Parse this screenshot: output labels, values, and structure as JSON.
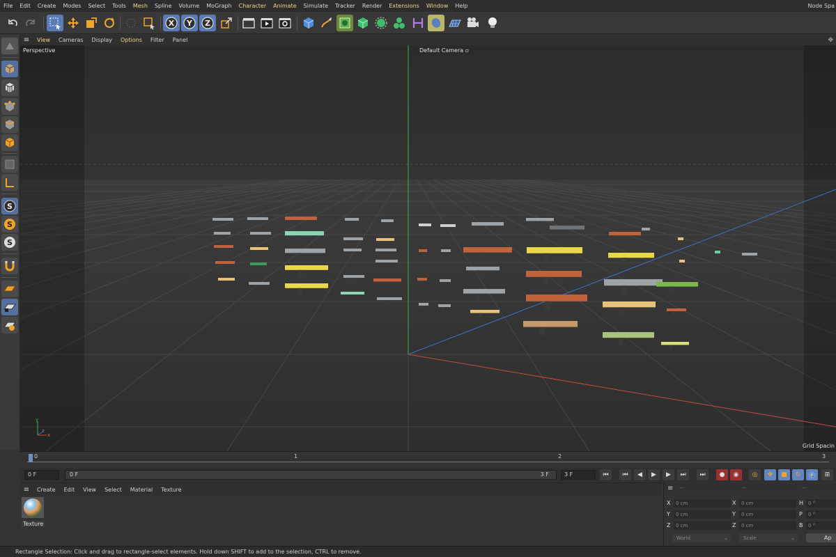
{
  "menu": {
    "items": [
      {
        "label": "File",
        "highlight": false
      },
      {
        "label": "Edit",
        "highlight": false
      },
      {
        "label": "Create",
        "highlight": false
      },
      {
        "label": "Modes",
        "highlight": false
      },
      {
        "label": "Select",
        "highlight": false
      },
      {
        "label": "Tools",
        "highlight": false
      },
      {
        "label": "Mesh",
        "highlight": true
      },
      {
        "label": "Spline",
        "highlight": false
      },
      {
        "label": "Volume",
        "highlight": false
      },
      {
        "label": "MoGraph",
        "highlight": false
      },
      {
        "label": "Character",
        "highlight": true
      },
      {
        "label": "Animate",
        "highlight": true
      },
      {
        "label": "Simulate",
        "highlight": false
      },
      {
        "label": "Tracker",
        "highlight": false
      },
      {
        "label": "Render",
        "highlight": false
      },
      {
        "label": "Extensions",
        "highlight": true
      },
      {
        "label": "Window",
        "highlight": true
      },
      {
        "label": "Help",
        "highlight": false
      }
    ],
    "layout_label": "Node Spa"
  },
  "toolbar": {
    "x_label": "X",
    "y_label": "Y",
    "z_label": "Z"
  },
  "left_palette": {
    "s_label": "S"
  },
  "viewport_menu": {
    "items": [
      {
        "label": "View",
        "highlight": true
      },
      {
        "label": "Cameras",
        "highlight": false
      },
      {
        "label": "Display",
        "highlight": false
      },
      {
        "label": "Options",
        "highlight": true
      },
      {
        "label": "Filter",
        "highlight": false
      },
      {
        "label": "Panel",
        "highlight": false
      }
    ]
  },
  "viewport": {
    "title": "Perspective",
    "camera_label": "Default Camera",
    "grid_label": "Grid Spacin",
    "axis_y": "y",
    "axis_z": "z",
    "axis_x": "x"
  },
  "timeline": {
    "ticks": [
      "0",
      "1",
      "2",
      "3"
    ]
  },
  "transport": {
    "start_frame": "0 F",
    "current_frame": "0 F",
    "end_frame_inner": "3 F",
    "end_frame": "3 F"
  },
  "material_manager": {
    "menu": [
      "Create",
      "Edit",
      "View",
      "Select",
      "Material",
      "Texture"
    ],
    "material_name": "Texture"
  },
  "coordinates": {
    "rows": [
      {
        "a": "X",
        "a_val": "0 cm",
        "b": "X",
        "b_val": "0 cm",
        "c": "H",
        "c_val": "0 °"
      },
      {
        "a": "Y",
        "a_val": "0 cm",
        "b": "Y",
        "b_val": "0 cm",
        "c": "P",
        "c_val": "0 °"
      },
      {
        "a": "Z",
        "a_val": "0 cm",
        "b": "Z",
        "b_val": "0 cm",
        "c": "B",
        "c_val": "0 °"
      }
    ],
    "mode_world": "World",
    "mode_scale": "Scale",
    "apply_label": "Ap"
  },
  "status": {
    "text": "Rectangle Selection: Click and drag to rectangle-select elements. Hold down SHIFT to add to the selection, CTRL to remove."
  },
  "colors": {
    "accent_blue": "#6286c0",
    "highlight_yellow": "#f1d48a",
    "axis_green": "#3fae4f",
    "axis_red": "#c84a3c",
    "axis_blue": "#3d6fc8"
  }
}
